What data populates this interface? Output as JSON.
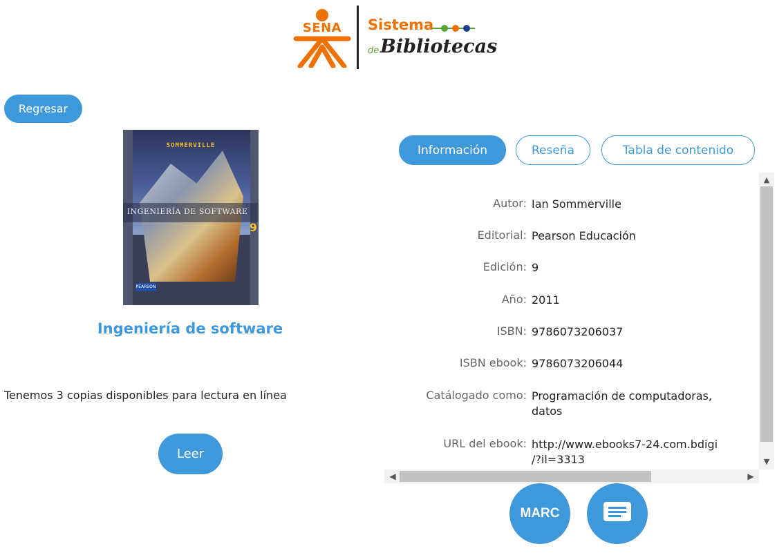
{
  "header": {
    "logo_org": "SENA",
    "logo_line1": "Sistema",
    "logo_de": "de",
    "logo_line2": "Bibliotecas",
    "brand_orange": "#ee7203",
    "brand_green": "#59a533"
  },
  "nav": {
    "back_label": "Regresar"
  },
  "book": {
    "cover": {
      "author_text": "SOMMERVILLE",
      "title_text": "INGENIERÍA DE SOFTWARE",
      "edition_mark": "9",
      "publisher_text": "PEARSON"
    },
    "title": "Ingeniería de software",
    "copies_text": "Tenemos 3 copias disponibles para lectura en línea",
    "read_label": "Leer"
  },
  "tabs": [
    {
      "label": "Información",
      "active": true
    },
    {
      "label": "Reseña",
      "active": false
    },
    {
      "label": "Tabla de contenido",
      "active": false
    }
  ],
  "info_rows": [
    {
      "label": "Autor:",
      "value": "Ian Sommerville"
    },
    {
      "label": "Editorial:",
      "value": "Pearson Educación"
    },
    {
      "label": "Edición:",
      "value": "9"
    },
    {
      "label": "Año:",
      "value": "2011"
    },
    {
      "label": "ISBN:",
      "value": "9786073206037"
    },
    {
      "label": "ISBN ebook:",
      "value": "9786073206044"
    },
    {
      "label": "Catálogado como:",
      "value": "Programación de computadoras,\ndatos"
    },
    {
      "label": "URL del ebook:",
      "value": "http://www.ebooks7-24.com.bdigi\n/?il=3313"
    }
  ],
  "actions": {
    "marc_label": "MARC",
    "cite_icon": "document-lines-icon"
  },
  "colors": {
    "accent": "#3f98da",
    "label_gray": "#666666"
  }
}
